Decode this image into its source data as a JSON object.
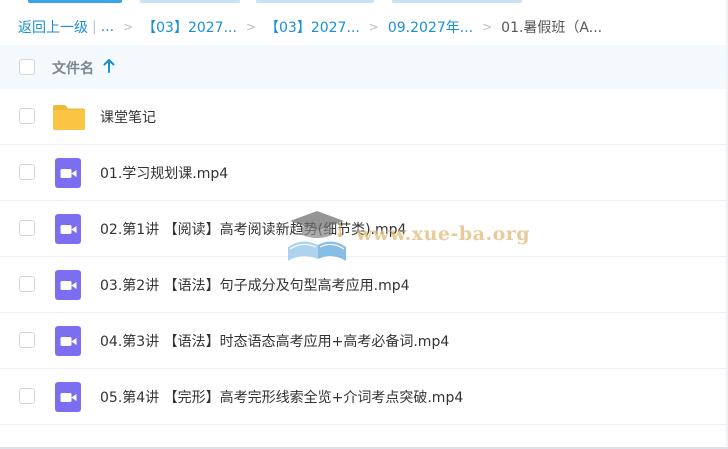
{
  "breadcrumb": {
    "back_label": "返回上一级",
    "separator": "|",
    "ellipsis": "...",
    "crumbs": [
      "【03】2027...",
      "【03】2027...",
      "09.2027年..."
    ],
    "current": "01.暑假班（A..."
  },
  "table": {
    "column_title": "文件名",
    "sort_icon": "arrow-up-icon"
  },
  "files": [
    {
      "name": "课堂笔记",
      "icon": "folder-icon"
    },
    {
      "name": "01.学习规划课.mp4",
      "icon": "video-file-icon"
    },
    {
      "name": "02.第1讲 【阅读】高考阅读新趋势(细节类).mp4",
      "icon": "video-file-icon"
    },
    {
      "name": "03.第2讲 【语法】句子成分及句型高考应用.mp4",
      "icon": "video-file-icon"
    },
    {
      "name": "04.第3讲 【语法】时态语态高考应用+高考必备词.mp4",
      "icon": "video-file-icon"
    },
    {
      "name": "05.第4讲 【完形】高考完形线索全览+介词考点突破.mp4",
      "icon": "video-file-icon"
    }
  ],
  "watermark": {
    "text": "www.xue-ba.org"
  },
  "colors": {
    "link": "#1a8fd6",
    "header_bg": "#f4f9fd",
    "folder": "#f9c543",
    "video": "#7b6ef0"
  }
}
